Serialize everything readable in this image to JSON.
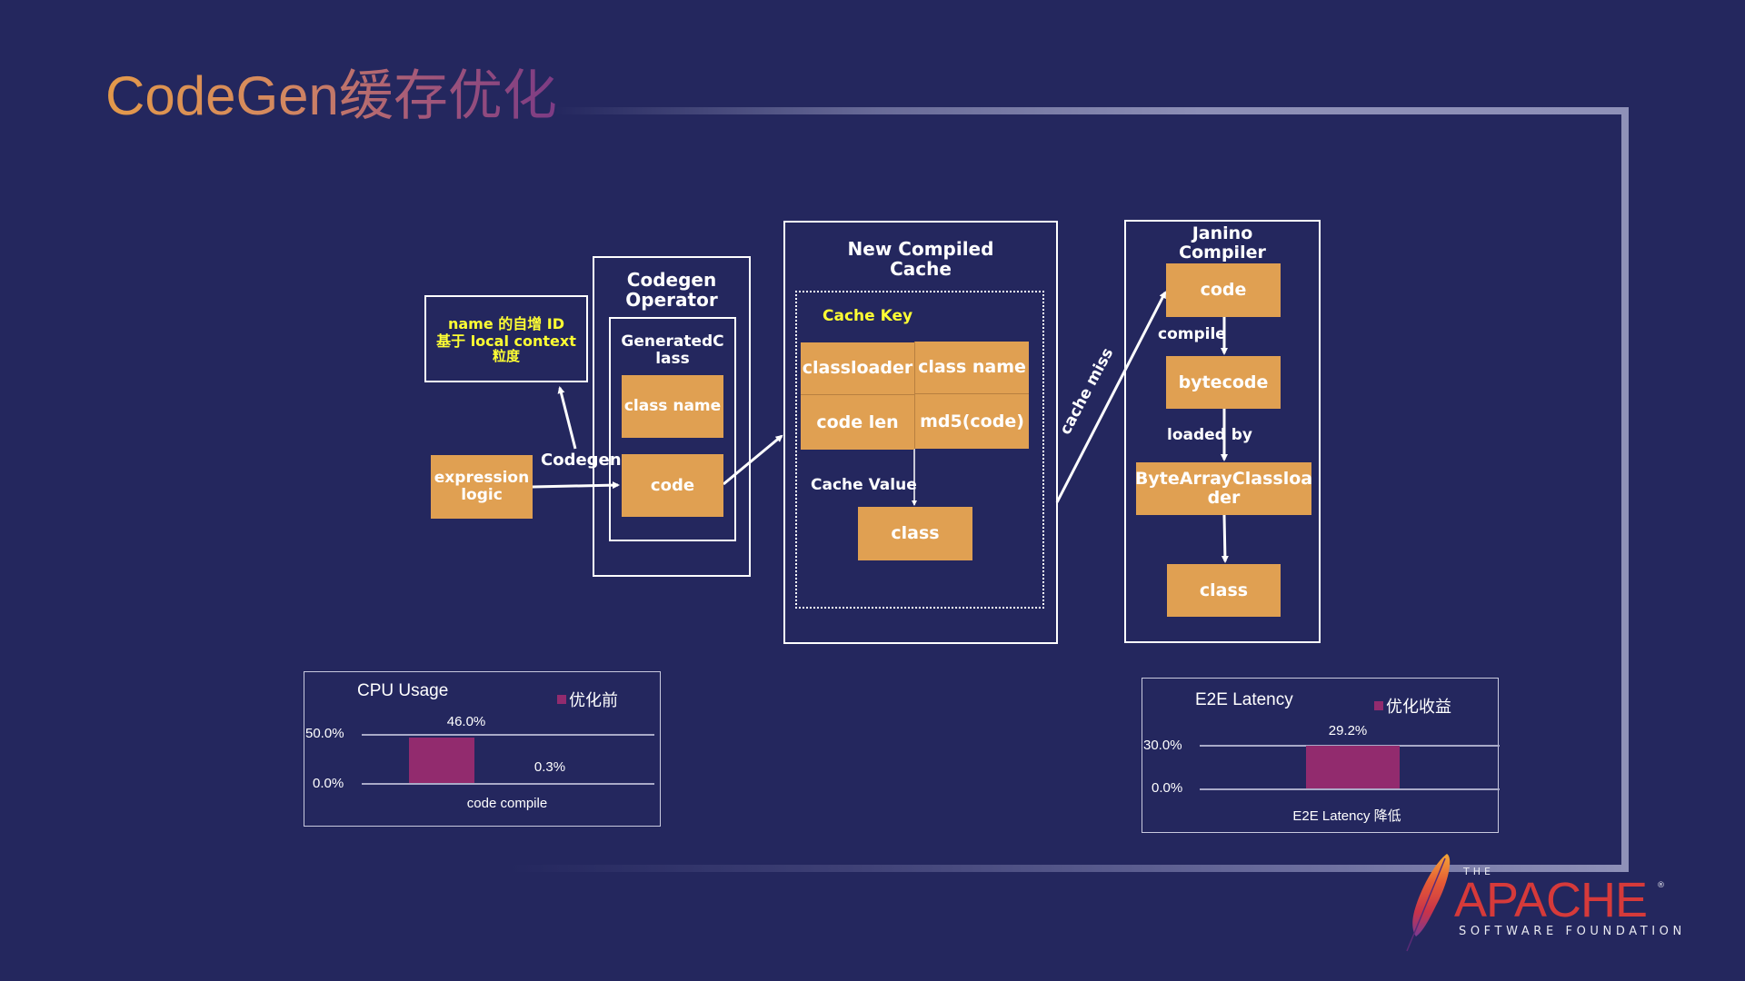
{
  "slide": {
    "title": "CodeGen缓存优化"
  },
  "diagram": {
    "annotation": {
      "line1": "name 的自增 ID",
      "line2": "基于 local context",
      "line3": "粒度"
    },
    "expression_logic": {
      "line1": "expression",
      "line2": "logic"
    },
    "codegen_edge_label": "Codegen",
    "codegen_operator": {
      "title_line1": "Codegen",
      "title_line2": "Operator",
      "generated_class_line1": "GeneratedC",
      "generated_class_line2": "lass",
      "class_name": "class name",
      "code": "code"
    },
    "compiled_cache": {
      "title_line1": "New Compiled",
      "title_line2": "Cache",
      "cache_key_label": "Cache Key",
      "key_cells": [
        "classloader",
        "class name",
        "code len",
        "md5(code)"
      ],
      "cache_value_label": "Cache Value",
      "value": "class"
    },
    "cache_miss_label": "cache miss",
    "janino": {
      "title_line1": "Janino",
      "title_line2": "Compiler",
      "code": "code",
      "compile_label": "compile",
      "bytecode": "bytecode",
      "loaded_by_label": "loaded by",
      "classloader_line1": "ByteArrayClassloa",
      "classloader_line2": "der",
      "class": "class"
    }
  },
  "colors": {
    "background": "#24275e",
    "node_fill": "#e0a052",
    "bar_fill": "#922b6e",
    "highlight_text": "#ffff33",
    "apache_red": "#d63a3a"
  },
  "chart_data": [
    {
      "type": "bar",
      "title": "CPU Usage",
      "legend": [
        "优化前"
      ],
      "legend_position": "top-right",
      "categories": [
        "code compile"
      ],
      "series": [
        {
          "name": "优化前",
          "values": [
            46.0
          ]
        },
        {
          "name": "",
          "values": [
            0.3
          ]
        }
      ],
      "data_labels": [
        "46.0%",
        "0.3%"
      ],
      "yticks": [
        "0.0%",
        "50.0%"
      ],
      "ylim": [
        0,
        50
      ],
      "grid": true,
      "xlabel": "",
      "ylabel": ""
    },
    {
      "type": "bar",
      "title": "E2E Latency",
      "legend": [
        "优化收益"
      ],
      "legend_position": "top-right",
      "categories": [
        "E2E Latency 降低"
      ],
      "series": [
        {
          "name": "优化收益",
          "values": [
            29.2
          ]
        }
      ],
      "data_labels": [
        "29.2%"
      ],
      "yticks": [
        "0.0%",
        "30.0%"
      ],
      "ylim": [
        0,
        30
      ],
      "grid": true,
      "xlabel": "",
      "ylabel": ""
    }
  ],
  "logo": {
    "the": "THE",
    "name": "APACHE",
    "registered": "®",
    "subtitle": "SOFTWARE FOUNDATION"
  }
}
